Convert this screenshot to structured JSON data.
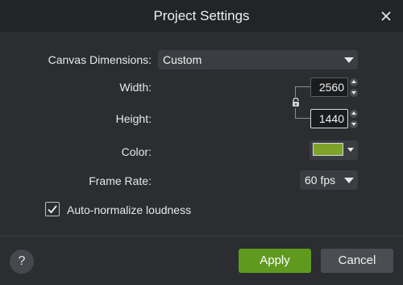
{
  "dialog": {
    "title": "Project Settings"
  },
  "canvas_dimensions": {
    "label": "Canvas Dimensions:",
    "value": "Custom"
  },
  "width": {
    "label": "Width:",
    "value": "2560"
  },
  "height": {
    "label": "Height:",
    "value": "1440"
  },
  "color": {
    "label": "Color:",
    "swatch": "#7fa22b"
  },
  "frame_rate": {
    "label": "Frame Rate:",
    "value": "60 fps"
  },
  "auto_normalize": {
    "label": "Auto-normalize loudness",
    "checked": true
  },
  "footer": {
    "help": "?",
    "apply": "Apply",
    "cancel": "Cancel"
  },
  "colors": {
    "accent": "#5f9a1f",
    "background": "#2b2d31"
  }
}
